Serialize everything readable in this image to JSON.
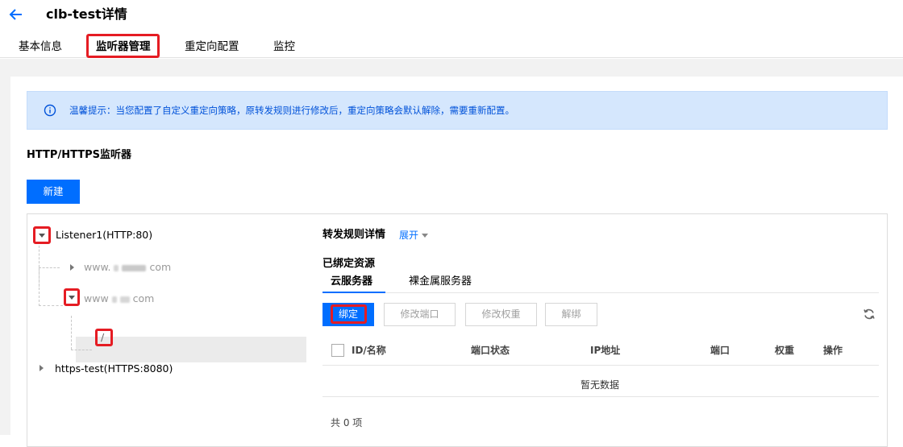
{
  "header": {
    "title": "clb-test详情",
    "tabs": [
      {
        "label": "基本信息"
      },
      {
        "label": "监听器管理"
      },
      {
        "label": "重定向配置"
      },
      {
        "label": "监控"
      }
    ]
  },
  "notice": {
    "text": "温馨提示：当您配置了自定义重定向策略，原转发规则进行修改后，重定向策略会默认解除，需要重新配置。"
  },
  "section": {
    "title": "HTTP/HTTPS监听器",
    "new_button": "新建"
  },
  "tree": {
    "listener1": "Listener1(HTTP:80)",
    "domain1_prefix": "www.",
    "domain1_suffix": "com",
    "domain2_prefix": "www",
    "domain2_suffix": "com",
    "path": "/",
    "listener2": "https-test(HTTPS:8080)"
  },
  "rules": {
    "title": "转发规则详情",
    "expand": "展开",
    "bound_title": "已绑定资源",
    "subtabs": [
      {
        "label": "云服务器"
      },
      {
        "label": "裸金属服务器"
      }
    ],
    "buttons": {
      "bind": "绑定",
      "modify_port": "修改端口",
      "modify_weight": "修改权重",
      "unbind": "解绑"
    },
    "columns": [
      "ID/名称",
      "端口状态",
      "IP地址",
      "端口",
      "权重",
      "操作"
    ],
    "empty": "暂无数据",
    "total": "共 0 项"
  },
  "colors": {
    "accent": "#006eff",
    "highlight": "#e51c23",
    "notice_bg": "#d5e7fd"
  }
}
